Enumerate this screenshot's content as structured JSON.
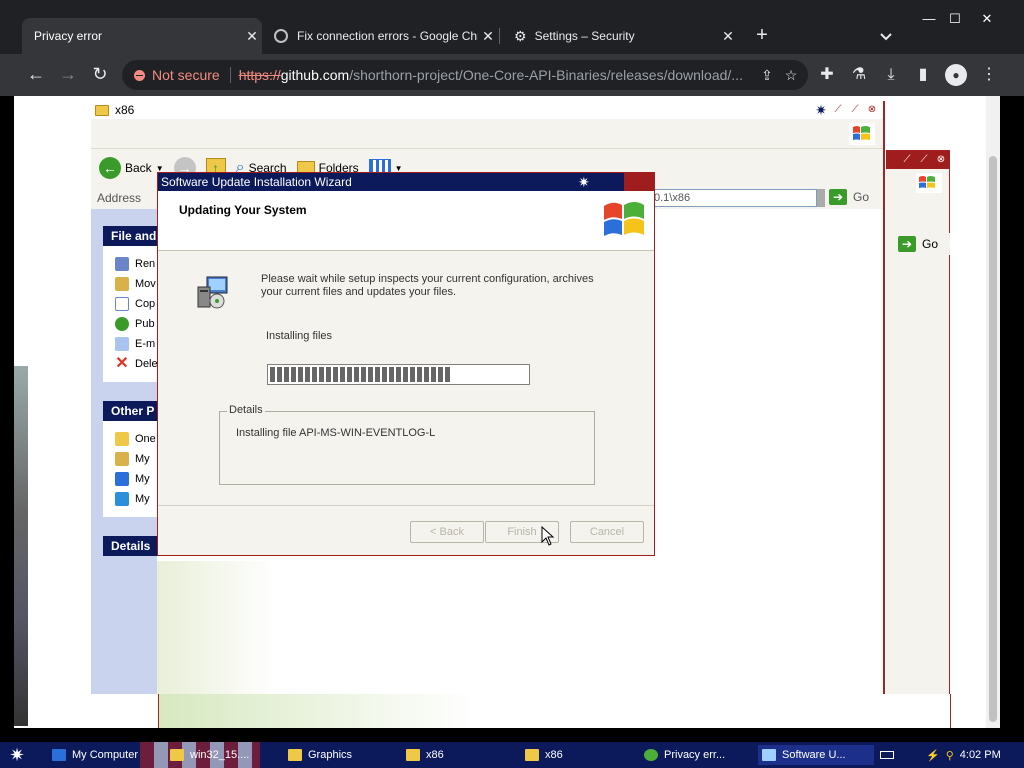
{
  "browser": {
    "tabs": [
      {
        "title": "Privacy error",
        "active": true
      },
      {
        "title": "Fix connection errors - Google Chr",
        "active": false
      },
      {
        "title": "Settings – Security",
        "active": false
      }
    ],
    "omnibox": {
      "security_label": "Not secure",
      "url_scheme": "https://",
      "url_host": "github.com",
      "url_path": "/shorthorn-project/One-Core-API-Binaries/releases/download/..."
    }
  },
  "explorer": {
    "title": "x86",
    "toolbar": {
      "back": "Back",
      "search": "Search",
      "folders": "Folders"
    },
    "address_label": "Address",
    "address_value": "0.1\\x86",
    "go_label": "Go",
    "back_window_go": "Go",
    "task_sections": [
      "File and",
      "Other P",
      "Details"
    ],
    "file_tasks": [
      "Ren",
      "Mov",
      "Cop",
      "Pub",
      "E-m",
      "Dele"
    ],
    "other_places": [
      "One",
      "My",
      "My",
      "My"
    ]
  },
  "wizard": {
    "title": "Software Update Installation Wizard",
    "header": "Updating Your System",
    "description": "Please wait while setup inspects your current configuration, archives your current files and updates your files.",
    "status": "Installing files",
    "progress": 0.71,
    "details_label": "Details",
    "details_text": "Installing file API-MS-WIN-EVENTLOG-L",
    "buttons": {
      "back": "< Back",
      "finish": "Finish",
      "cancel": "Cancel"
    }
  },
  "taskbar": {
    "items": [
      "My Computer",
      "win32_15....",
      "Graphics",
      "x86",
      "x86",
      "Privacy err...",
      "Software U..."
    ],
    "clock": "4:02 PM"
  },
  "colors": {
    "chrome_dark": "#202124",
    "chrome_toolbar": "#35363a",
    "xp_navy": "#0c1a5c",
    "xp_red": "#a52323",
    "not_secure": "#f28b82"
  }
}
